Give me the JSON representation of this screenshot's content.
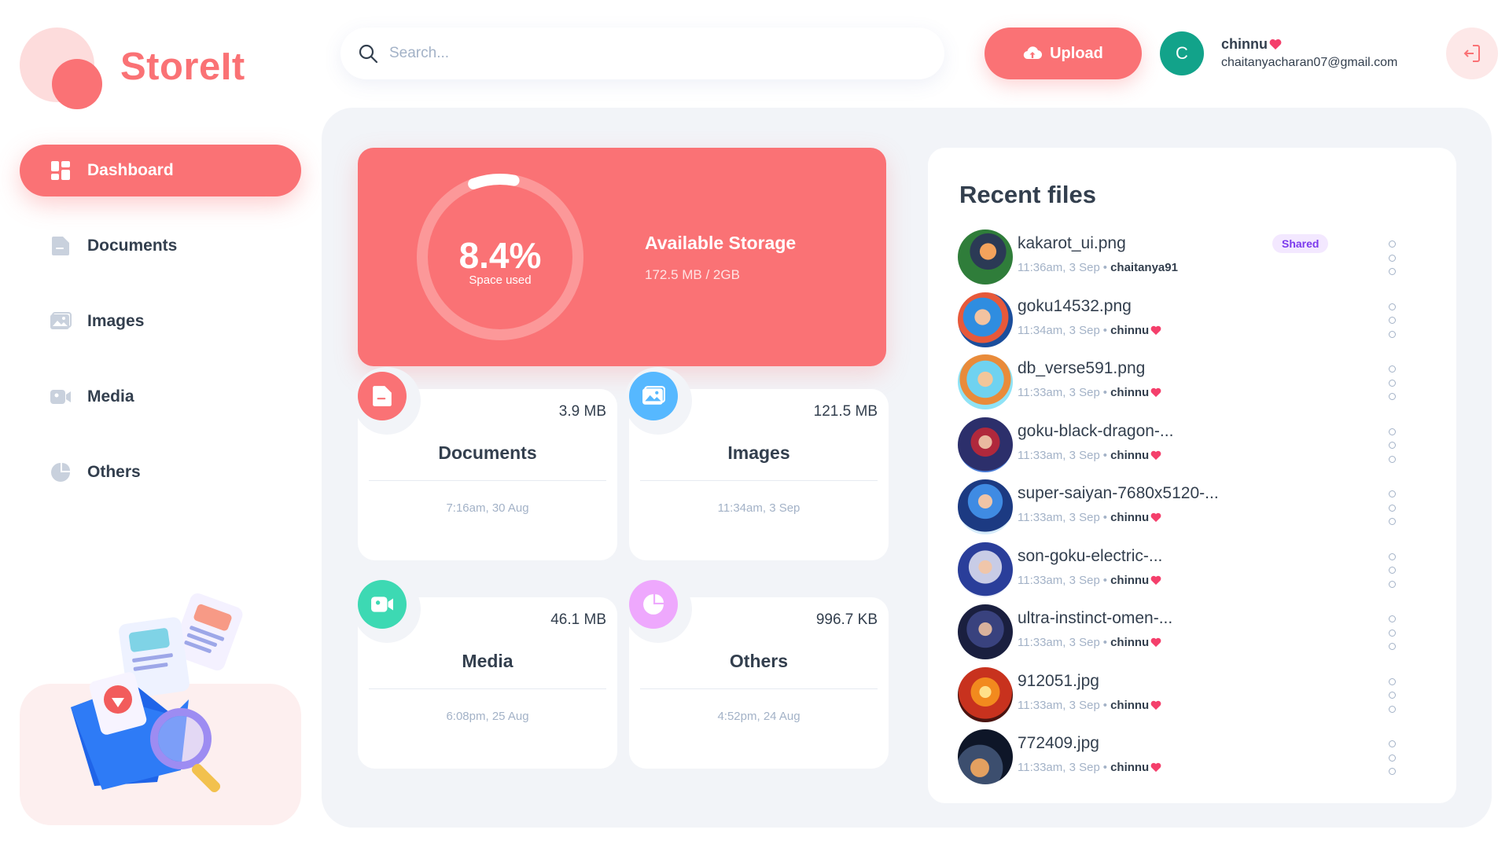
{
  "brand": {
    "name": "StoreIt",
    "primary": "#FA7275",
    "surface": "#F2F4F8"
  },
  "search": {
    "placeholder": "Search..."
  },
  "header": {
    "upload_label": "Upload",
    "user": {
      "initial": "C",
      "name": "chinnu",
      "email": "chaitanyacharan07@gmail.com"
    }
  },
  "sidebar": {
    "items": [
      {
        "label": "Dashboard",
        "icon": "dashboard-icon",
        "active": true
      },
      {
        "label": "Documents",
        "icon": "documents-icon",
        "active": false
      },
      {
        "label": "Images",
        "icon": "images-icon",
        "active": false
      },
      {
        "label": "Media",
        "icon": "media-icon",
        "active": false
      },
      {
        "label": "Others",
        "icon": "others-icon",
        "active": false
      }
    ]
  },
  "storage": {
    "percent_label": "8.4%",
    "percent_value": 8.4,
    "subtitle": "Space used",
    "title": "Available Storage",
    "amount": "172.5 MB / 2GB"
  },
  "categories": [
    {
      "name": "Documents",
      "size": "3.9 MB",
      "time": "7:16am, 30 Aug",
      "icon": "documents-icon",
      "color": "#FA7275"
    },
    {
      "name": "Images",
      "size": "121.5 MB",
      "time": "11:34am, 3 Sep",
      "icon": "images-icon",
      "color": "#56B8FF"
    },
    {
      "name": "Media",
      "size": "46.1 MB",
      "time": "6:08pm, 25 Aug",
      "icon": "media-icon",
      "color": "#3DD9B3"
    },
    {
      "name": "Others",
      "size": "996.7 KB",
      "time": "4:52pm, 24 Aug",
      "icon": "others-icon",
      "color": "#EEA8FD"
    }
  ],
  "recent": {
    "title": "Recent files",
    "files": [
      {
        "name": "kakarot_ui.png",
        "time": "11:36am, 3 Sep",
        "owner": "chaitanya91",
        "heart": false,
        "shared": "Shared"
      },
      {
        "name": "goku14532.png",
        "time": "11:34am, 3 Sep",
        "owner": "chinnu",
        "heart": true,
        "shared": ""
      },
      {
        "name": "db_verse591.png",
        "time": "11:33am, 3 Sep",
        "owner": "chinnu",
        "heart": true,
        "shared": ""
      },
      {
        "name": "goku-black-dragon-...",
        "time": "11:33am, 3 Sep",
        "owner": "chinnu",
        "heart": true,
        "shared": ""
      },
      {
        "name": "super-saiyan-7680x5120-...",
        "time": "11:33am, 3 Sep",
        "owner": "chinnu",
        "heart": true,
        "shared": ""
      },
      {
        "name": "son-goku-electric-...",
        "time": "11:33am, 3 Sep",
        "owner": "chinnu",
        "heart": true,
        "shared": ""
      },
      {
        "name": "ultra-instinct-omen-...",
        "time": "11:33am, 3 Sep",
        "owner": "chinnu",
        "heart": true,
        "shared": ""
      },
      {
        "name": "912051.jpg",
        "time": "11:33am, 3 Sep",
        "owner": "chinnu",
        "heart": true,
        "shared": ""
      },
      {
        "name": "772409.jpg",
        "time": "11:33am, 3 Sep",
        "owner": "chinnu",
        "heart": true,
        "shared": ""
      }
    ]
  }
}
